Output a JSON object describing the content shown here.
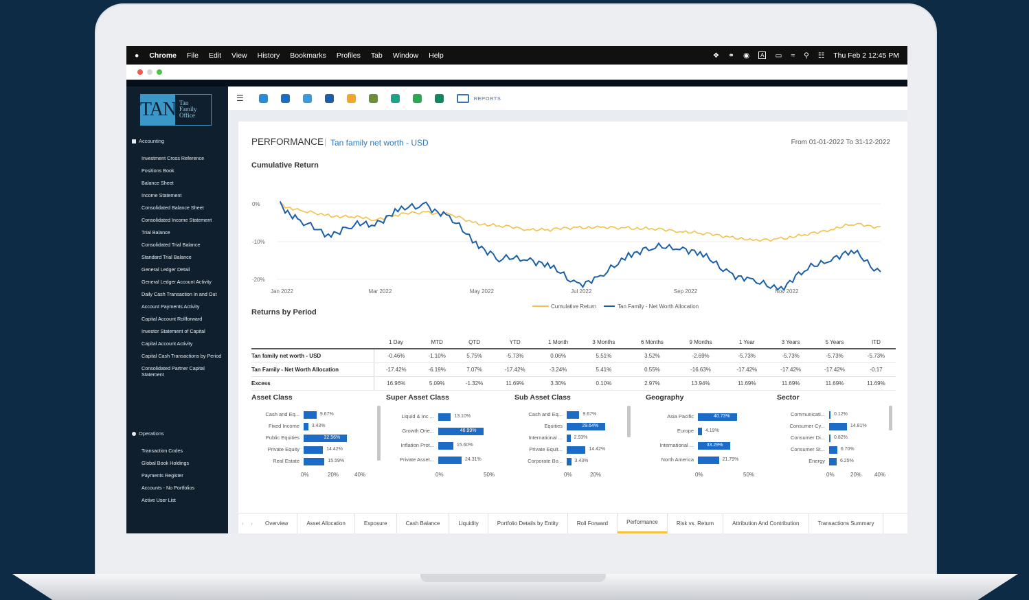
{
  "menubar": {
    "app": "Chrome",
    "items": [
      "File",
      "Edit",
      "View",
      "History",
      "Bookmarks",
      "Profiles",
      "Tab",
      "Window",
      "Help"
    ],
    "clock": "Thu Feb 2  12:45 PM",
    "input_indicator": "A"
  },
  "logo": {
    "mark": "TAN",
    "line1": "Tan",
    "line2": "Family",
    "line3": "Office"
  },
  "sidebar": {
    "accounting_title": "Accounting",
    "accounting_items": [
      "Investment Cross Reference",
      "Positions Book",
      "Balance Sheet",
      "Income Statement",
      "Consolidated Balance Sheet",
      "Consolidated Income Statement",
      "Trial Balance",
      "Consolidated Trial Balance",
      "Standard Trial Balance",
      "General Ledger Detail",
      "General Ledger Account Activity",
      "Daily Cash Transaction In and Out",
      "Account Payments Activity",
      "Capital Account Rollforward",
      "Investor Statement of Capital",
      "Capital Account Activity",
      "Capital Cash Transactions by Period",
      "Consolidated Partner Capital Statement"
    ],
    "operations_title": "Operations",
    "operations_items": [
      "Transaction Codes",
      "Global Book Holdings",
      "Payments Register",
      "Accounts - No Portfolios",
      "Active User List"
    ]
  },
  "toolbar": {
    "reports_label": "REPORTS"
  },
  "header": {
    "title": "PERFORMANCE",
    "subtitle": "Tan family net worth - USD",
    "date_range": "From  01-01-2022 To 31-12-2022"
  },
  "chart_data": {
    "type": "line",
    "title": "Cumulative Return",
    "x_ticks": [
      "Jan 2022",
      "Mar 2022",
      "May 2022",
      "Jul 2022",
      "Sep 2022",
      "Nov 2022"
    ],
    "y_ticks": [
      "0%",
      "-10%",
      "-20%"
    ],
    "ylim": [
      -24,
      2
    ],
    "series": [
      {
        "name": "Cumulative Return",
        "color": "#f2c14a",
        "x": [
          "2022-01-03",
          "2022-01-15",
          "2022-02-01",
          "2022-02-15",
          "2022-03-01",
          "2022-03-15",
          "2022-04-01",
          "2022-04-15",
          "2022-05-01",
          "2022-05-15",
          "2022-06-01",
          "2022-06-15",
          "2022-07-01",
          "2022-07-15",
          "2022-08-01",
          "2022-08-15",
          "2022-09-01",
          "2022-09-15",
          "2022-10-01",
          "2022-10-15",
          "2022-11-01",
          "2022-11-15",
          "2022-12-01",
          "2022-12-15",
          "2022-12-31"
        ],
        "values": [
          0,
          -2,
          -3,
          -3.5,
          -4,
          -3,
          -2,
          -3,
          -5,
          -6,
          -6.5,
          -7,
          -6,
          -6.5,
          -6.2,
          -6.8,
          -7,
          -8,
          -8.5,
          -10,
          -9,
          -8.5,
          -6.5,
          -5.5,
          -6
        ]
      },
      {
        "name": "Tan Family - Net Worth Allocation",
        "color": "#1b5fa8",
        "x": [
          "2022-01-03",
          "2022-01-15",
          "2022-02-01",
          "2022-02-15",
          "2022-03-01",
          "2022-03-15",
          "2022-04-01",
          "2022-04-15",
          "2022-05-01",
          "2022-05-15",
          "2022-06-01",
          "2022-06-15",
          "2022-07-01",
          "2022-07-15",
          "2022-08-01",
          "2022-08-15",
          "2022-09-01",
          "2022-09-15",
          "2022-10-01",
          "2022-10-15",
          "2022-11-01",
          "2022-11-15",
          "2022-12-01",
          "2022-12-15",
          "2022-12-31"
        ],
        "values": [
          0,
          -5,
          -8,
          -6,
          -5,
          -2,
          0,
          -4,
          -10,
          -15,
          -14,
          -17,
          -21,
          -20,
          -13,
          -12,
          -11,
          -14,
          -18,
          -21,
          -22,
          -18,
          -14,
          -13,
          -18
        ]
      }
    ]
  },
  "returns": {
    "title": "Returns by Period",
    "columns": [
      "1 Day",
      "MTD",
      "QTD",
      "YTD",
      "1 Month",
      "3 Months",
      "6 Months",
      "9 Months",
      "1 Year",
      "3 Years",
      "5 Years",
      "ITD"
    ],
    "rows": [
      {
        "label": "Tan family net worth - USD",
        "values": [
          "-0.46%",
          "-1.10%",
          "5.75%",
          "-5.73%",
          "0.06%",
          "5.51%",
          "3.52%",
          "-2.69%",
          "-5.73%",
          "-5.73%",
          "-5.73%",
          "-5.73%"
        ]
      },
      {
        "label": "Tan Family - Net Worth Allocation",
        "values": [
          "-17.42%",
          "-6.19%",
          "7.07%",
          "-17.42%",
          "-3.24%",
          "5.41%",
          "0.55%",
          "-16.63%",
          "-17.42%",
          "-17.42%",
          "-17.42%",
          "-0.17"
        ]
      },
      {
        "label": "Excess",
        "values": [
          "16.96%",
          "5.09%",
          "-1.32%",
          "11.69%",
          "3.30%",
          "0.10%",
          "2.97%",
          "13.94%",
          "11.69%",
          "11.69%",
          "11.69%",
          "11.69%"
        ]
      }
    ]
  },
  "breakdowns": [
    {
      "title": "Asset Class",
      "max": 40,
      "ticks": [
        "0%",
        "20%",
        "40%"
      ],
      "items": [
        {
          "label": "Cash and Eq...",
          "value": 9.67,
          "text": "9.67%"
        },
        {
          "label": "Fixed Income",
          "value": 3.43,
          "text": "3.43%"
        },
        {
          "label": "Public Equities",
          "value": 32.56,
          "text": "32.56%"
        },
        {
          "label": "Private Equity",
          "value": 14.42,
          "text": "14.42%"
        },
        {
          "label": "Real Estate",
          "value": 15.59,
          "text": "15.59%"
        }
      ]
    },
    {
      "title": "Super Asset Class",
      "max": 50,
      "ticks": [
        "0%",
        "50%"
      ],
      "items": [
        {
          "label": "Liquid & Inc ...",
          "value": 13.1,
          "text": "13.10%"
        },
        {
          "label": "Growth Orie...",
          "value": 46.99,
          "text": "46.99%"
        },
        {
          "label": "Inflation Prot...",
          "value": 15.6,
          "text": "15.60%"
        },
        {
          "label": "Private Asset...",
          "value": 24.31,
          "text": "24.31%"
        }
      ]
    },
    {
      "title": "Sub Asset Class",
      "max": 40,
      "ticks": [
        "0%",
        "20%"
      ],
      "items": [
        {
          "label": "Cash and Eq...",
          "value": 9.67,
          "text": "9.67%"
        },
        {
          "label": "Equities",
          "value": 29.64,
          "text": "29.64%"
        },
        {
          "label": "International ...",
          "value": 2.93,
          "text": "2.93%"
        },
        {
          "label": "Private Equit...",
          "value": 14.42,
          "text": "14.42%"
        },
        {
          "label": "Corporate Bo...",
          "value": 3.43,
          "text": "3.43%"
        }
      ]
    },
    {
      "title": "Geography",
      "max": 50,
      "ticks": [
        "0%",
        "50%"
      ],
      "items": [
        {
          "label": "Asia Pacific",
          "value": 40.73,
          "text": "40.73%"
        },
        {
          "label": "Europe",
          "value": 4.19,
          "text": "4.19%"
        },
        {
          "label": "International ...",
          "value": 33.29,
          "text": "33.29%"
        },
        {
          "label": "North America",
          "value": 21.79,
          "text": "21.79%"
        }
      ]
    },
    {
      "title": "Sector",
      "max": 40,
      "ticks": [
        "0%",
        "20%",
        "40%"
      ],
      "items": [
        {
          "label": "Communicati...",
          "value": 0.12,
          "text": "0.12%"
        },
        {
          "label": "Consumer Cy...",
          "value": 14.81,
          "text": "14.81%"
        },
        {
          "label": "Consumer Di...",
          "value": 0.82,
          "text": "0.82%"
        },
        {
          "label": "Consumer St...",
          "value": 6.7,
          "text": "6.70%"
        },
        {
          "label": "Energy",
          "value": 6.25,
          "text": "6.25%"
        }
      ]
    }
  ],
  "tabs": {
    "items": [
      "Overview",
      "Asset Allocation",
      "Exposure",
      "Cash Balance",
      "Liquidity",
      "Portfolio Details by Entity",
      "Roll Forward",
      "Performance",
      "Risk vs. Return",
      "Attribution And Contribution",
      "Transactions Summary"
    ],
    "active": "Performance"
  },
  "colors": {
    "accent": "#1c6bc6",
    "gold": "#f2c14a",
    "sidebar": "#0f1f2e",
    "background": "#0d2b45"
  }
}
